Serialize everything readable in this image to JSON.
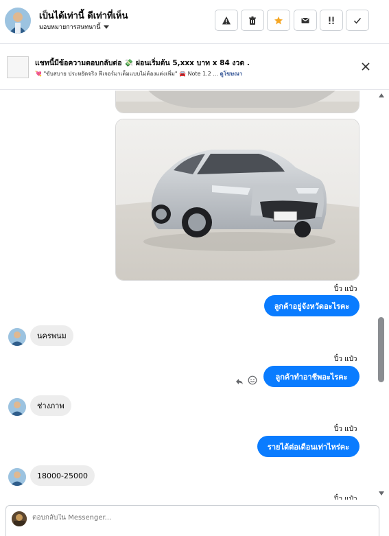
{
  "header": {
    "name": "เป็นได้เท่านี้ ดีเท่าที่เห็น",
    "subtitle": "มอบหมายการสนทนานี้",
    "buttons": [
      {
        "name": "warning",
        "icon": "warning-icon"
      },
      {
        "name": "delete",
        "icon": "trash-icon"
      },
      {
        "name": "star",
        "icon": "star-icon",
        "accent": "#f5a623"
      },
      {
        "name": "mail",
        "icon": "mail-icon"
      },
      {
        "name": "urgent",
        "icon": "exclamation-icon"
      },
      {
        "name": "done",
        "icon": "check-icon"
      }
    ]
  },
  "banner": {
    "title": "แชทนี้มีข้อความตอบกลับต่อ 💸 ผ่อนเริ่มต้น 5,xxx บาท x 84 งวด .",
    "subtitle": "💘 \"ขับสบาย ประหยัดจริง ฟีเจอร์มาเต็มแบบไม่ต้องแต่งเพิ่ม\" 🚘 Note 1.2 ...",
    "link": "ดูโฆษณา"
  },
  "messages": [
    {
      "type": "image",
      "alt": "car-photo-partial"
    },
    {
      "type": "image",
      "alt": "silver-mazda3-hatchback"
    },
    {
      "type": "meta",
      "text": "ปิ๋ว แป๋ว"
    },
    {
      "type": "outgoing",
      "text": "ลูกค้าอยู่จังหวัดอะไรคะ"
    },
    {
      "type": "incoming",
      "text": "นครพนม"
    },
    {
      "type": "meta",
      "text": "ปิ๋ว แป๋ว"
    },
    {
      "type": "outgoing",
      "text": "ลูกค้าทำอาชีพอะไรคะ"
    },
    {
      "type": "incoming",
      "text": "ช่างภาพ"
    },
    {
      "type": "meta",
      "text": "ปิ๋ว แป๋ว"
    },
    {
      "type": "outgoing",
      "text": "รายได้ต่อเดือนเท่าไหร่คะ"
    },
    {
      "type": "incoming",
      "text": "18000-25000"
    },
    {
      "type": "meta",
      "text": "ปิ๋ว แป๋ว"
    }
  ],
  "composer": {
    "placeholder": "ตอบกลับใน Messenger..."
  },
  "colors": {
    "accent": "#0a7cff",
    "incoming_bg": "#ededed"
  }
}
